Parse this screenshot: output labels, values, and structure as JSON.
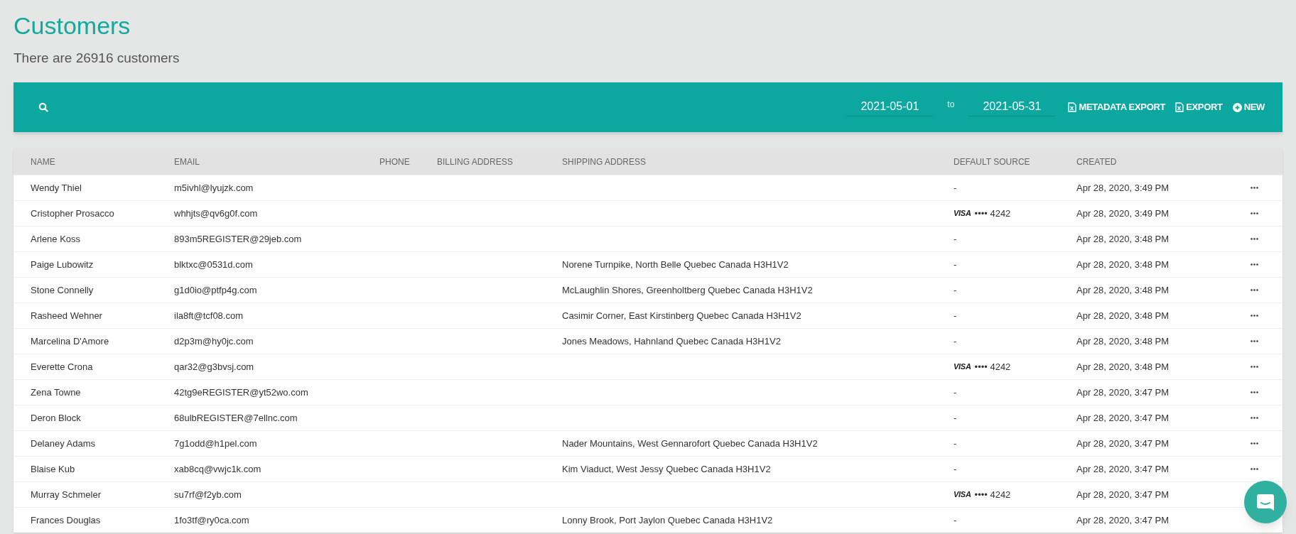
{
  "page": {
    "title": "Customers",
    "subtitle": "There are 26916 customers"
  },
  "toolbar": {
    "date_from": "2021-05-01",
    "separator": "to",
    "date_to": "2021-05-31",
    "buttons": [
      {
        "kind": "export",
        "label": "METADATA EXPORT"
      },
      {
        "kind": "export",
        "label": "EXPORT"
      },
      {
        "kind": "new",
        "label": "NEW"
      }
    ]
  },
  "table": {
    "columns": [
      "NAME",
      "EMAIL",
      "PHONE",
      "BILLING ADDRESS",
      "SHIPPING ADDRESS",
      "DEFAULT SOURCE",
      "CREATED"
    ],
    "rows": [
      {
        "name": "Wendy Thiel",
        "email": "m5ivhl@lyujzk.com",
        "shipping": "",
        "source": {
          "kind": "none",
          "text": "-"
        },
        "created": "Apr 28, 2020, 3:49 PM",
        "menu": true
      },
      {
        "name": "Cristopher Prosacco",
        "email": "whhjts@qv6g0f.com",
        "shipping": "",
        "source": {
          "kind": "card",
          "brand": "VISA",
          "dots": "••••",
          "last4": "4242"
        },
        "created": "Apr 28, 2020, 3:49 PM",
        "menu": true
      },
      {
        "name": "Arlene Koss",
        "email": "893m5REGISTER@29jeb.com",
        "shipping": "",
        "source": {
          "kind": "none",
          "text": "-"
        },
        "created": "Apr 28, 2020, 3:48 PM",
        "menu": true
      },
      {
        "name": "Paige Lubowitz",
        "email": "blktxc@0531d.com",
        "shipping": "Norene Turnpike, North Belle Quebec Canada H3H1V2",
        "source": {
          "kind": "none",
          "text": "-"
        },
        "created": "Apr 28, 2020, 3:48 PM",
        "menu": true
      },
      {
        "name": "Stone Connelly",
        "email": "g1d0io@ptfp4g.com",
        "shipping": "McLaughlin Shores, Greenholtberg Quebec Canada H3H1V2",
        "source": {
          "kind": "none",
          "text": "-"
        },
        "created": "Apr 28, 2020, 3:48 PM",
        "menu": true
      },
      {
        "name": "Rasheed Wehner",
        "email": "ila8ft@tcf08.com",
        "shipping": "Casimir Corner, East Kirstinberg Quebec Canada H3H1V2",
        "source": {
          "kind": "none",
          "text": "-"
        },
        "created": "Apr 28, 2020, 3:48 PM",
        "menu": true
      },
      {
        "name": "Marcelina D'Amore",
        "email": "d2p3m@hy0jc.com",
        "shipping": "Jones Meadows, Hahnland Quebec Canada H3H1V2",
        "source": {
          "kind": "none",
          "text": "-"
        },
        "created": "Apr 28, 2020, 3:48 PM",
        "menu": true
      },
      {
        "name": "Everette Crona",
        "email": "qar32@g3bvsj.com",
        "shipping": "",
        "source": {
          "kind": "card",
          "brand": "VISA",
          "dots": "••••",
          "last4": "4242"
        },
        "created": "Apr 28, 2020, 3:48 PM",
        "menu": true
      },
      {
        "name": "Zena Towne",
        "email": "42tg9eREGISTER@yt52wo.com",
        "shipping": "",
        "source": {
          "kind": "none",
          "text": "-"
        },
        "created": "Apr 28, 2020, 3:47 PM",
        "menu": true
      },
      {
        "name": "Deron Block",
        "email": "68ulbREGISTER@7ellnc.com",
        "shipping": "",
        "source": {
          "kind": "none",
          "text": "-"
        },
        "created": "Apr 28, 2020, 3:47 PM",
        "menu": true
      },
      {
        "name": "Delaney Adams",
        "email": "7g1odd@h1pel.com",
        "shipping": "Nader Mountains, West Gennarofort Quebec Canada H3H1V2",
        "source": {
          "kind": "none",
          "text": "-"
        },
        "created": "Apr 28, 2020, 3:47 PM",
        "menu": true
      },
      {
        "name": "Blaise Kub",
        "email": "xab8cq@vwjc1k.com",
        "shipping": "Kim Viaduct, West Jessy Quebec Canada H3H1V2",
        "source": {
          "kind": "none",
          "text": "-"
        },
        "created": "Apr 28, 2020, 3:47 PM",
        "menu": true
      },
      {
        "name": "Murray Schmeler",
        "email": "su7rf@f2yb.com",
        "shipping": "",
        "source": {
          "kind": "card",
          "brand": "VISA",
          "dots": "••••",
          "last4": "4242"
        },
        "created": "Apr 28, 2020, 3:47 PM",
        "menu": false
      },
      {
        "name": "Frances Douglas",
        "email": "1fo3tf@ry0ca.com",
        "shipping": "Lonny Brook, Port Jaylon Quebec Canada H3H1V2",
        "source": {
          "kind": "none",
          "text": "-"
        },
        "created": "Apr 28, 2020, 3:47 PM",
        "menu": false
      }
    ]
  },
  "chat_button": true
}
